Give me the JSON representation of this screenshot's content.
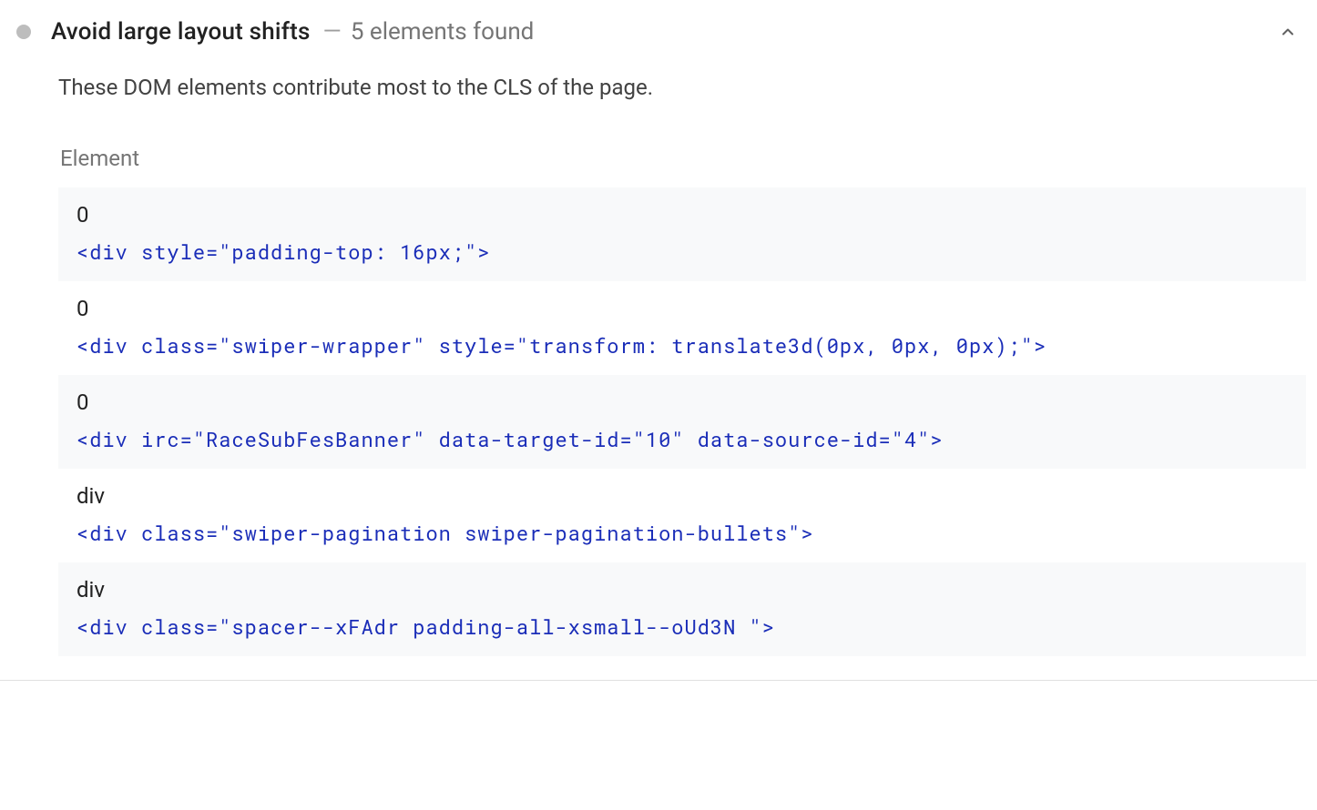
{
  "audit": {
    "title": "Avoid large layout shifts",
    "separator": "—",
    "subtitle": "5 elements found",
    "description": "These DOM elements contribute most to the CLS of the page.",
    "column_header": "Element",
    "rows": [
      {
        "label": "0",
        "code": "<div style=\"padding-top: 16px;\">"
      },
      {
        "label": "0",
        "code": "<div class=\"swiper-wrapper\" style=\"transform: translate3d(0px, 0px, 0px);\">"
      },
      {
        "label": "0",
        "code": "<div irc=\"RaceSubFesBanner\" data-target-id=\"10\" data-source-id=\"4\">"
      },
      {
        "label": "div",
        "code": "<div class=\"swiper-pagination swiper-pagination-bullets\">"
      },
      {
        "label": "div",
        "code": "<div class=\"spacer--xFAdr padding-all-xsmall--oUd3N \">"
      }
    ]
  }
}
